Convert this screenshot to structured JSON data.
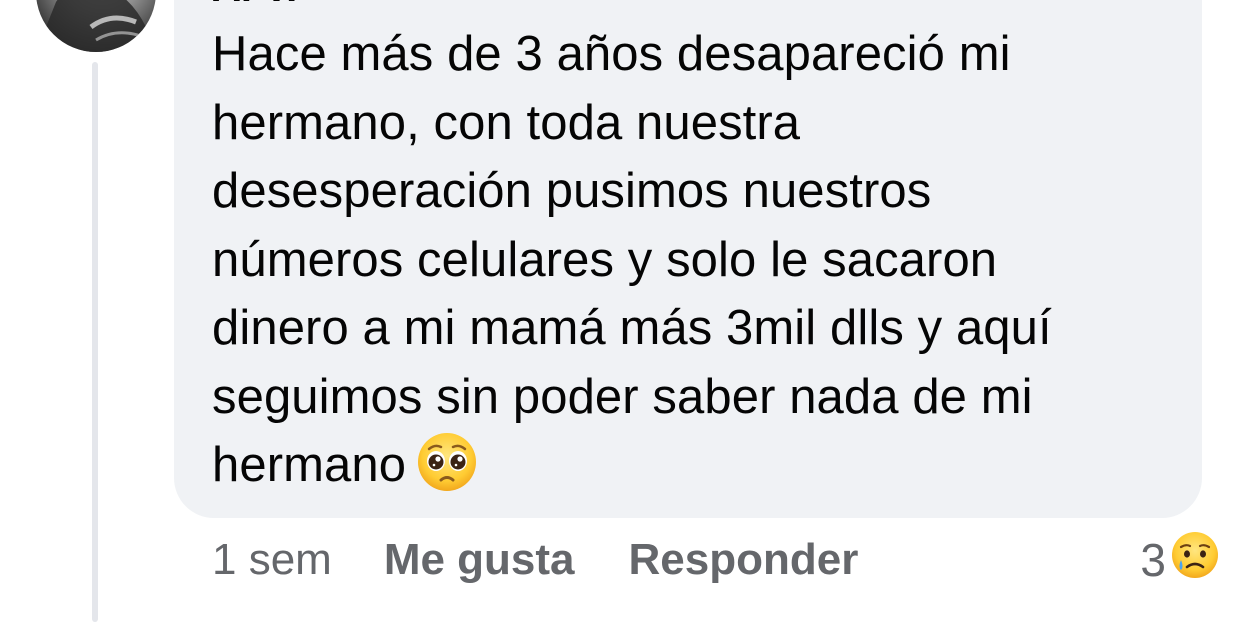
{
  "comment": {
    "author_name": "A. V.",
    "text": "Hace más de 3 años desapareció mi hermano, con toda nuestra desesperación pusimos nuestros números celulares y solo le sacaron dinero a mi mamá más 3mil dlls y aquí seguimos sin poder saber nada de mi hermano",
    "lines": [
      "Hace más de 3 años desapareció mi",
      "hermano, con toda nuestra",
      "desesperación pusimos nuestros",
      "números celulares y solo le sacaron",
      "dinero a mi mamá más 3mil dlls y aquí",
      "seguimos sin poder saber nada de mi",
      "hermano"
    ],
    "trailing_emoji": "pleading-face-emoji"
  },
  "actions": {
    "timestamp": "1 sem",
    "like_label": "Me gusta",
    "reply_label": "Responder"
  },
  "reactions": {
    "count": "3",
    "icon": "sad-crying-face-emoji"
  },
  "colors": {
    "bubble_bg": "#f0f2f5",
    "text": "#050505",
    "secondary_text": "#65676b",
    "thread_line": "#e4e6eb"
  }
}
